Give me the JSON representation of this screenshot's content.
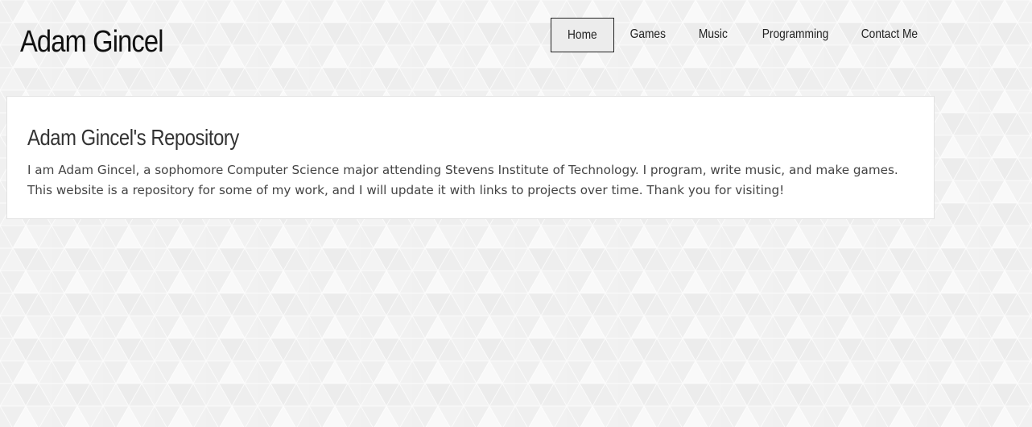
{
  "header": {
    "site_title": "Adam Gincel"
  },
  "nav": {
    "items": [
      {
        "label": "Home",
        "active": true
      },
      {
        "label": "Games",
        "active": false
      },
      {
        "label": "Music",
        "active": false
      },
      {
        "label": "Programming",
        "active": false
      },
      {
        "label": "Contact Me",
        "active": false
      }
    ]
  },
  "main": {
    "title": "Adam Gincel's Repository",
    "body": "I am Adam Gincel, a sophomore Computer Science major attending Stevens Institute of Technology. I program, write music, and make games. This website is a repository for some of my work, and I will update it with links to projects over time. Thank you for visiting!"
  },
  "colors": {
    "background": "#f6f6f6",
    "pattern": "#eaeaea",
    "card": "#ffffff",
    "text": "#444444",
    "active_nav_bg": "#ececec"
  }
}
